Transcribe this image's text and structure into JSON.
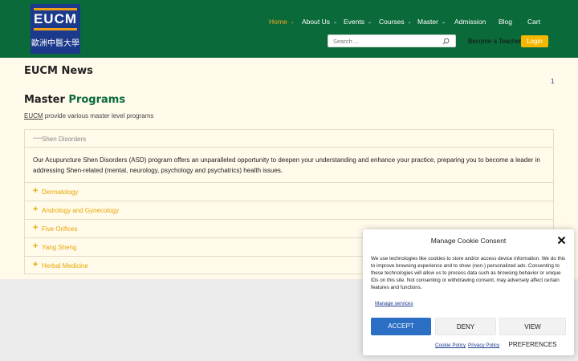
{
  "logo": {
    "wordmark": "EUCM",
    "chinese": "歐洲中醫大學"
  },
  "nav": {
    "items": [
      {
        "label": "Home",
        "active": true,
        "has_dropdown": true
      },
      {
        "label": "About Us",
        "active": false,
        "has_dropdown": true
      },
      {
        "label": "Events",
        "active": false,
        "has_dropdown": true
      },
      {
        "label": "Courses",
        "active": false,
        "has_dropdown": true
      },
      {
        "label": "Master",
        "active": false,
        "has_dropdown": true
      },
      {
        "label": "Admission",
        "active": false,
        "has_dropdown": false
      },
      {
        "label": "Blog",
        "active": false,
        "has_dropdown": false
      },
      {
        "label": "Cart",
        "active": false,
        "has_dropdown": false
      }
    ],
    "search_placeholder": "Search ...",
    "search_icon": "search-icon",
    "become_teacher": "Become a Teacher",
    "login": "Login"
  },
  "main": {
    "news_title": "EUCM News",
    "page_number": "1",
    "programs_title_a": "Master",
    "programs_title_b": "Programs",
    "programs_subtitle_a": "EUCM",
    "programs_subtitle_b": "provide various master level programs",
    "accordion": {
      "open": {
        "label": "Shen Disorders",
        "body": "Our Acupuncture Shen Disorders (ASD) program offers an unparalleled opportunity to deepen your understanding and enhance your practice, preparing you to become a leader in addressing Shen-related (mental, neurology, psychology and psychatrics) health issues."
      },
      "items": [
        {
          "label": "Dermatology"
        },
        {
          "label": "Andrology and Gynecology"
        },
        {
          "label": "Five Orifices"
        },
        {
          "label": "Yang Sheng"
        },
        {
          "label": "Herbal Medicine"
        }
      ]
    }
  },
  "cookie": {
    "title": "Manage Cookie Consent",
    "text": "We use technologies like cookies to store and/or access device information. We do this to improve browsing experience and to show (non-) personalized ads. Consenting to these technologies will allow us to process data such as browsing behavior or unique IDs on this site. Not consenting or withdrawing consent, may adversely affect certain features and functions.",
    "manage_services": "Manage services",
    "accept": "ACCEPT",
    "deny": "DENY",
    "view_preferences": "VIEW PREFERENCES",
    "cookie_policy": "Cookie Policy",
    "privacy_policy": "Privacy Policy"
  },
  "colors": {
    "header_green": "#0a6a3a",
    "accent_orange": "#f5a623",
    "accordion_gold": "#e7a600",
    "content_bg": "#fffaea",
    "accept_blue": "#2a6fc4",
    "logo_blue": "#1b3a8c"
  }
}
